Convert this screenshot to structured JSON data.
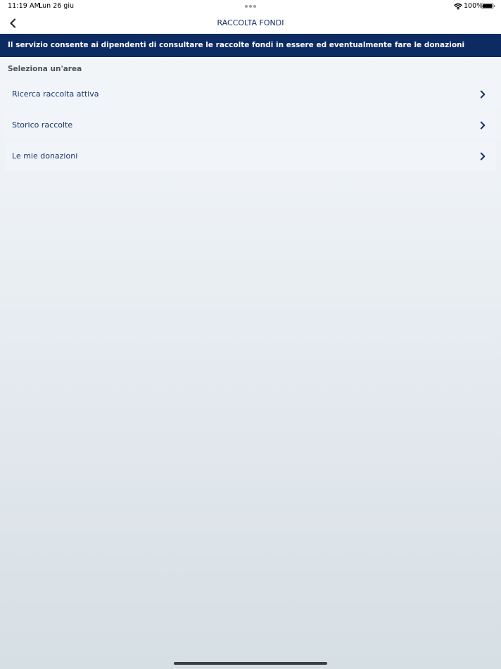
{
  "status_bar": {
    "time": "11:19 AM",
    "date": "Lun 26 giu",
    "battery": "100%",
    "icons": [
      "more-dots-icon",
      "wifi-icon",
      "battery-icon"
    ]
  },
  "nav": {
    "title": "RACCOLTA FONDI",
    "back_icon": "chevron-left-icon"
  },
  "banner": {
    "text": "Il servizio consente ai dipendenti di consultare le raccolte fondi in essere ed eventualmente fare le donazioni"
  },
  "section": {
    "label": "Seleziona un'area"
  },
  "menu": {
    "items": [
      {
        "label": "Ricerca raccolta attiva",
        "icon": "chevron-right-icon"
      },
      {
        "label": "Storico raccolte",
        "icon": "chevron-right-icon"
      },
      {
        "label": "Le mie donazioni",
        "icon": "chevron-right-icon"
      }
    ]
  },
  "colors": {
    "primary_navy": "#0d2b63",
    "menu_text": "#17346d",
    "menu_bg": "#f1f4f8"
  }
}
